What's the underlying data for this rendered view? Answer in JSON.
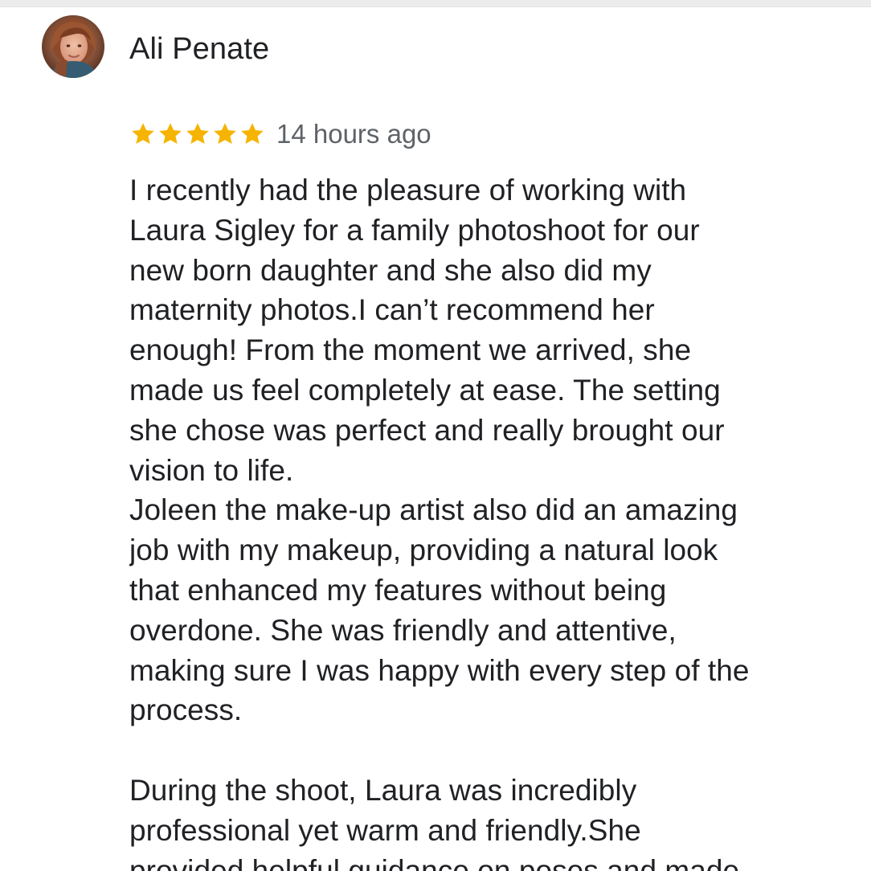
{
  "review": {
    "reviewer_name": "Ali Penate",
    "avatar_icon": "profile-photo",
    "rating": 5,
    "rating_max": 5,
    "star_color": "#f6b400",
    "time_ago": "14 hours ago",
    "body_lines": [
      "I recently had the pleasure of working with",
      "Laura Sigley for a family photoshoot for our",
      "new born daughter and she also did my",
      "maternity photos.I can’t recommend her",
      "enough! From the moment we arrived, she",
      "made us feel completely at ease. The setting",
      "she chose was perfect and really brought our",
      "vision to life.",
      "Joleen the make-up artist also did an amazing",
      "job with my makeup, providing a natural look",
      "that enhanced my features without being",
      "overdone. She was friendly and attentive,",
      "making sure I was happy with every step of the",
      "process.",
      "",
      "During the shoot, Laura was incredibly",
      "professional yet warm and friendly.She",
      "provided helpful guidance on poses and made"
    ]
  }
}
